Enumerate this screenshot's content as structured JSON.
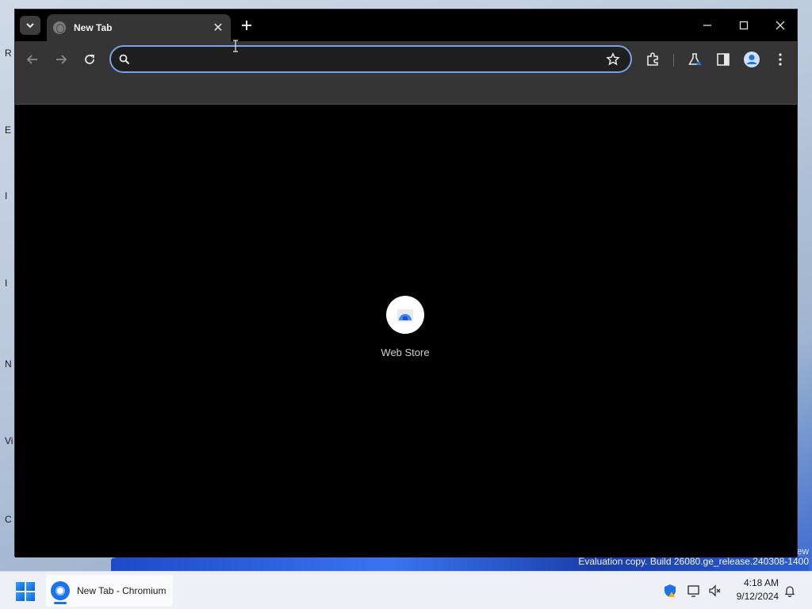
{
  "desktop": {
    "peek_labels": [
      "R",
      "E",
      "I",
      "I",
      "N",
      "Vi",
      "C"
    ]
  },
  "browser": {
    "tab": {
      "title": "New Tab"
    },
    "omnibox": {
      "value": "",
      "placeholder": ""
    },
    "shortcuts": [
      {
        "label": "Web Store",
        "icon": "web-store-icon"
      }
    ]
  },
  "watermark": {
    "edge_text": "ew",
    "line": "Evaluation copy. Build 26080.ge_release.240308-1400"
  },
  "taskbar": {
    "app_label": "New Tab - Chromium",
    "time": "4:18 AM",
    "date": "9/12/2024"
  },
  "colors": {
    "accent": "#1a73e8",
    "omnibox_focus": "#7aa2e8",
    "browser_chrome": "#353535"
  }
}
